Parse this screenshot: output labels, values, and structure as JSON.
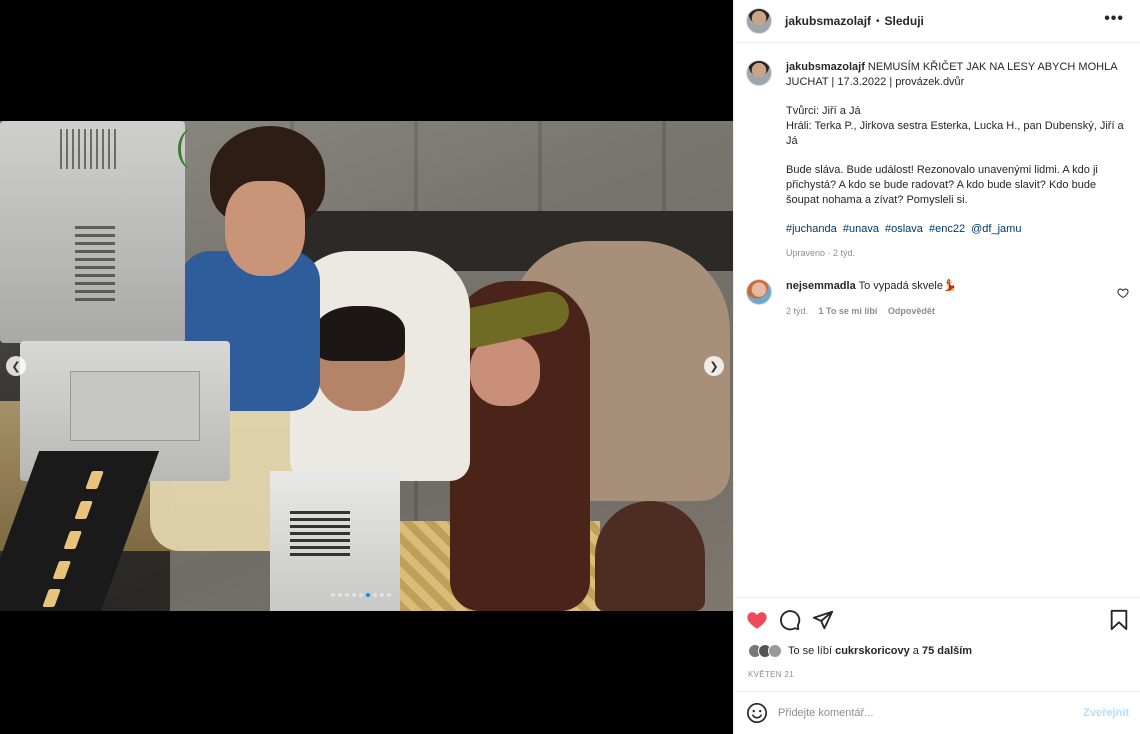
{
  "post": {
    "author": "jakubsmazolajf",
    "follow_label": "Sleduji",
    "dot": "•",
    "more": "•••",
    "caption_title": "NEMUSÍM KŘIČET JAK NA LESY ABYCH MOHLA JUCHAT | 17.3.2022 | provázek.dvůr",
    "caption_lines": [
      "Tvůrci: Jiří a Já",
      "Hráli: Terka P., Jirkova sestra Esterka, Lucka H., pan Dubenský, Jiří a Já",
      "Bude sláva. Bude událost! Rezonovalo unavenými lidmi. A kdo ji přichystá? A kdo se bude radovat? A kdo bude slavit? Kdo bude šoupat nohama a zívat? Pomysleli si."
    ],
    "hashtags": [
      "#juchanda",
      "#unava",
      "#oslava",
      "#enc22",
      "@df_jamu"
    ],
    "caption_meta": "Upraveno · 2 týd."
  },
  "comment": {
    "author": "nejsemmadla",
    "text": "To vypadá skvele💃",
    "time": "2 týd.",
    "likes": "1 To se mi líbí",
    "reply": "Odpovědět"
  },
  "likes": {
    "prefix": "To se líbí",
    "user": "cukrskoricovy",
    "middle": "a",
    "others": "75 dalším"
  },
  "date": "KVĚTEN 21",
  "add_comment": {
    "placeholder": "Přidejte komentář...",
    "post_label": "Zveřejnit"
  },
  "carousel": {
    "count": 9,
    "active_index": 5
  },
  "colors": {
    "liked_heart": "#ed4956",
    "link": "#00376b",
    "dot_active": "#0095f6",
    "post_disabled": "#b2dffc"
  },
  "icons": {
    "prev": "chevron-left-icon",
    "next": "chevron-right-icon",
    "like": "heart-filled-icon",
    "comment": "comment-bubble-icon",
    "share": "paper-plane-icon",
    "save": "bookmark-icon",
    "emoji": "smiley-icon"
  }
}
